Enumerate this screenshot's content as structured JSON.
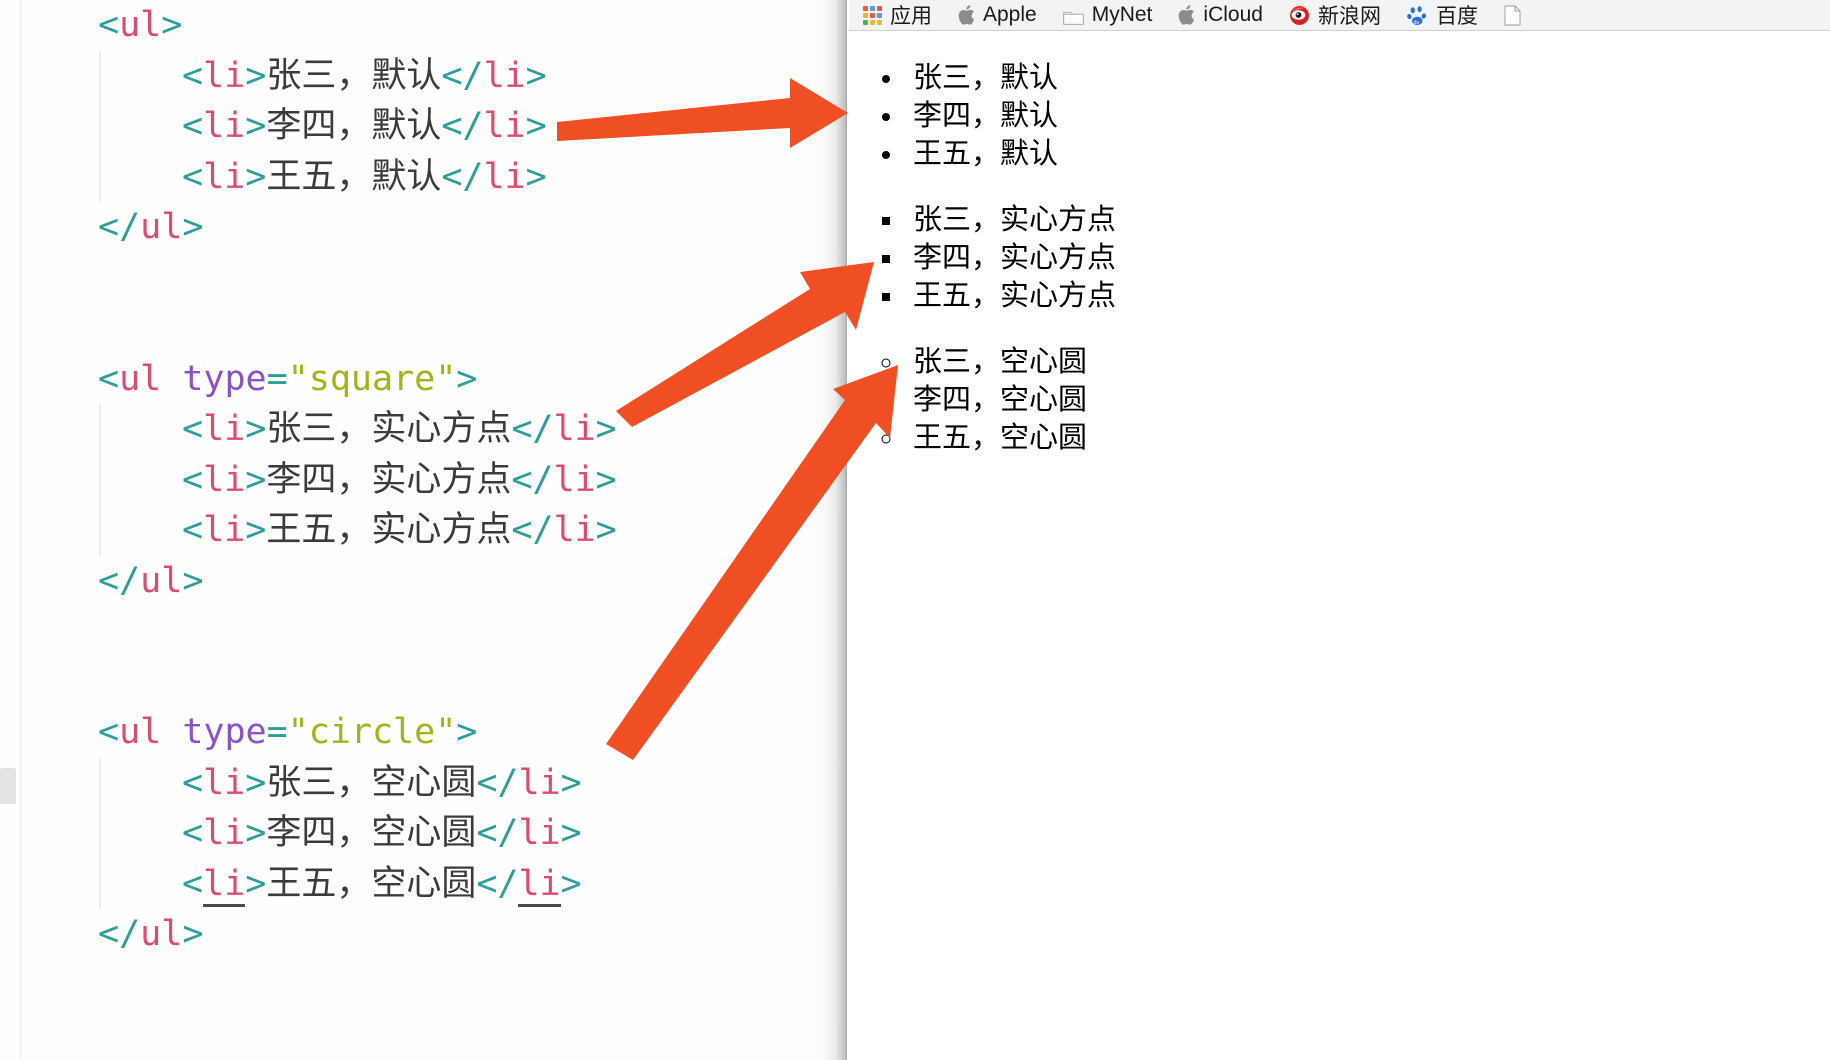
{
  "editor": {
    "language": "html",
    "colors": {
      "punctuation": "#2e9e9a",
      "tag": "#dd4b6e",
      "attribute": "#8b52c8",
      "value": "#a3b318",
      "text": "#3b3b3b",
      "background": "#fefefe"
    },
    "lines": [
      {
        "id": "l1",
        "indent": false,
        "tokens": [
          {
            "t": "pnc",
            "v": "<"
          },
          {
            "t": "tag",
            "v": "ul"
          },
          {
            "t": "pnc",
            "v": ">"
          }
        ]
      },
      {
        "id": "l2",
        "indent": true,
        "tokens": [
          {
            "t": "pnc",
            "v": "<"
          },
          {
            "t": "tag",
            "v": "li"
          },
          {
            "t": "pnc",
            "v": ">"
          },
          {
            "t": "txt",
            "v": "张三，默认"
          },
          {
            "t": "pnc",
            "v": "</"
          },
          {
            "t": "tag",
            "v": "li"
          },
          {
            "t": "pnc",
            "v": ">"
          }
        ]
      },
      {
        "id": "l3",
        "indent": true,
        "tokens": [
          {
            "t": "pnc",
            "v": "<"
          },
          {
            "t": "tag",
            "v": "li"
          },
          {
            "t": "pnc",
            "v": ">"
          },
          {
            "t": "txt",
            "v": "李四，默认"
          },
          {
            "t": "pnc",
            "v": "</"
          },
          {
            "t": "tag",
            "v": "li"
          },
          {
            "t": "pnc",
            "v": ">"
          }
        ]
      },
      {
        "id": "l4",
        "indent": true,
        "tokens": [
          {
            "t": "pnc",
            "v": "<"
          },
          {
            "t": "tag",
            "v": "li"
          },
          {
            "t": "pnc",
            "v": ">"
          },
          {
            "t": "txt",
            "v": "王五，默认"
          },
          {
            "t": "pnc",
            "v": "</"
          },
          {
            "t": "tag",
            "v": "li"
          },
          {
            "t": "pnc",
            "v": ">"
          }
        ]
      },
      {
        "id": "l5",
        "indent": false,
        "tokens": [
          {
            "t": "pnc",
            "v": "</"
          },
          {
            "t": "tag",
            "v": "ul"
          },
          {
            "t": "pnc",
            "v": ">"
          }
        ]
      },
      {
        "id": "l6",
        "indent": false,
        "tokens": []
      },
      {
        "id": "l7",
        "indent": false,
        "tokens": []
      },
      {
        "id": "l8",
        "indent": false,
        "tokens": [
          {
            "t": "pnc",
            "v": "<"
          },
          {
            "t": "tag",
            "v": "ul"
          },
          {
            "t": "txt",
            "v": " "
          },
          {
            "t": "attr",
            "v": "type"
          },
          {
            "t": "pnc",
            "v": "="
          },
          {
            "t": "val",
            "v": "\"square\""
          },
          {
            "t": "pnc",
            "v": ">"
          }
        ]
      },
      {
        "id": "l9",
        "indent": true,
        "tokens": [
          {
            "t": "pnc",
            "v": "<"
          },
          {
            "t": "tag",
            "v": "li"
          },
          {
            "t": "pnc",
            "v": ">"
          },
          {
            "t": "txt",
            "v": "张三，实心方点"
          },
          {
            "t": "pnc",
            "v": "</"
          },
          {
            "t": "tag",
            "v": "li"
          },
          {
            "t": "pnc",
            "v": ">"
          }
        ]
      },
      {
        "id": "l10",
        "indent": true,
        "tokens": [
          {
            "t": "pnc",
            "v": "<"
          },
          {
            "t": "tag",
            "v": "li"
          },
          {
            "t": "pnc",
            "v": ">"
          },
          {
            "t": "txt",
            "v": "李四，实心方点"
          },
          {
            "t": "pnc",
            "v": "</"
          },
          {
            "t": "tag",
            "v": "li"
          },
          {
            "t": "pnc",
            "v": ">"
          }
        ]
      },
      {
        "id": "l11",
        "indent": true,
        "tokens": [
          {
            "t": "pnc",
            "v": "<"
          },
          {
            "t": "tag",
            "v": "li"
          },
          {
            "t": "pnc",
            "v": ">"
          },
          {
            "t": "txt",
            "v": "王五，实心方点"
          },
          {
            "t": "pnc",
            "v": "</"
          },
          {
            "t": "tag",
            "v": "li"
          },
          {
            "t": "pnc",
            "v": ">"
          }
        ]
      },
      {
        "id": "l12",
        "indent": false,
        "tokens": [
          {
            "t": "pnc",
            "v": "</"
          },
          {
            "t": "tag",
            "v": "ul"
          },
          {
            "t": "pnc",
            "v": ">"
          }
        ]
      },
      {
        "id": "l13",
        "indent": false,
        "tokens": []
      },
      {
        "id": "l14",
        "indent": false,
        "tokens": []
      },
      {
        "id": "l15",
        "indent": false,
        "tokens": [
          {
            "t": "pnc",
            "v": "<"
          },
          {
            "t": "tag",
            "v": "ul"
          },
          {
            "t": "txt",
            "v": " "
          },
          {
            "t": "attr",
            "v": "type"
          },
          {
            "t": "pnc",
            "v": "="
          },
          {
            "t": "val",
            "v": "\"circle\""
          },
          {
            "t": "pnc",
            "v": ">"
          }
        ]
      },
      {
        "id": "l16",
        "indent": true,
        "tokens": [
          {
            "t": "pnc",
            "v": "<"
          },
          {
            "t": "tag",
            "v": "li"
          },
          {
            "t": "pnc",
            "v": ">"
          },
          {
            "t": "txt",
            "v": "张三，空心圆"
          },
          {
            "t": "pnc",
            "v": "</"
          },
          {
            "t": "tag",
            "v": "li"
          },
          {
            "t": "pnc",
            "v": ">"
          }
        ]
      },
      {
        "id": "l17",
        "indent": true,
        "tokens": [
          {
            "t": "pnc",
            "v": "<"
          },
          {
            "t": "tag",
            "v": "li"
          },
          {
            "t": "pnc",
            "v": ">"
          },
          {
            "t": "txt",
            "v": "李四，空心圆"
          },
          {
            "t": "pnc",
            "v": "</"
          },
          {
            "t": "tag",
            "v": "li"
          },
          {
            "t": "pnc",
            "v": ">"
          }
        ]
      },
      {
        "id": "l18",
        "indent": true,
        "underlineTags": true,
        "tokens": [
          {
            "t": "pnc",
            "v": "<"
          },
          {
            "t": "tag",
            "v": "li",
            "u": true
          },
          {
            "t": "pnc",
            "v": ">"
          },
          {
            "t": "txt",
            "v": "王五，空心圆"
          },
          {
            "t": "pnc",
            "v": "</"
          },
          {
            "t": "tag",
            "v": "li",
            "u": true
          },
          {
            "t": "pnc",
            "v": ">"
          }
        ]
      },
      {
        "id": "l19",
        "indent": false,
        "tokens": [
          {
            "t": "pnc",
            "v": "</"
          },
          {
            "t": "tag",
            "v": "ul"
          },
          {
            "t": "pnc",
            "v": ">"
          }
        ]
      }
    ]
  },
  "browser": {
    "bookmarks": [
      {
        "label": "应用",
        "icon": "apps-grid-icon"
      },
      {
        "label": "Apple",
        "icon": "apple-logo-icon"
      },
      {
        "label": "MyNet",
        "icon": "folder-icon"
      },
      {
        "label": "iCloud",
        "icon": "apple-logo-icon"
      },
      {
        "label": "新浪网",
        "icon": "sina-weibo-icon"
      },
      {
        "label": "百度",
        "icon": "baidu-paw-icon"
      },
      {
        "label": "",
        "icon": "page-icon"
      }
    ],
    "rendered_lists": [
      {
        "bullet": "disc",
        "bullet_label": "默认实心圆点",
        "items": [
          "张三，默认",
          "李四，默认",
          "王五，默认"
        ]
      },
      {
        "bullet": "square",
        "bullet_label": "实心方点",
        "items": [
          "张三，实心方点",
          "李四，实心方点",
          "王五，实心方点"
        ]
      },
      {
        "bullet": "circle",
        "bullet_label": "空心圆",
        "items": [
          "张三，空心圆",
          "李四，空心圆",
          "王五，空心圆"
        ]
      }
    ]
  },
  "annotations": {
    "arrow_color": "#f04e23",
    "arrows": [
      {
        "name": "arrow-default-list",
        "from": "code line <li>李四，默认</li>",
        "to": "rendered default bullet list"
      },
      {
        "name": "arrow-square-list",
        "from": "code line <li>张三，实心方点</li>",
        "to": "rendered square bullet list"
      },
      {
        "name": "arrow-circle-list",
        "from": "code line <li>李四，空心圆</li>",
        "to": "rendered circle bullet list"
      }
    ]
  }
}
